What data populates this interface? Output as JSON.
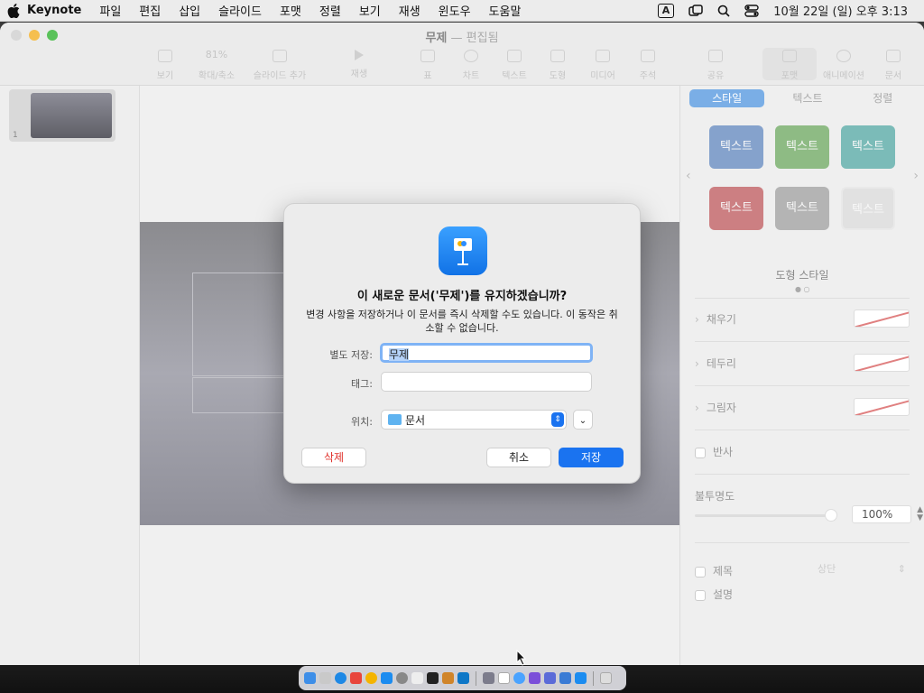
{
  "menubar": {
    "app_name": "Keynote",
    "items": [
      "파일",
      "편집",
      "삽입",
      "슬라이드",
      "포맷",
      "정렬",
      "보기",
      "재생",
      "윈도우",
      "도움말"
    ],
    "input_badge": "A",
    "clock": "10월 22일 (일) 오후 3:13"
  },
  "window": {
    "doc_name": "무제",
    "doc_status": "— 편집됨",
    "toolbar": {
      "view": "보기",
      "zoom_value": "81%",
      "zoom_label": "확대/축소",
      "add_slide": "슬라이드 추가",
      "play": "재생",
      "table": "표",
      "chart": "차트",
      "text": "텍스트",
      "shape": "도형",
      "media": "미디어",
      "comment": "주석",
      "share": "공유",
      "format": "포맷",
      "animate": "애니메이션",
      "document": "문서"
    }
  },
  "sidebar": {
    "slide_number": "1"
  },
  "inspector": {
    "tabs": [
      "스타일",
      "텍스트",
      "정렬"
    ],
    "style_buttons": [
      {
        "label": "텍스트",
        "color": "#3f6fb5"
      },
      {
        "label": "텍스트",
        "color": "#4e9a3e"
      },
      {
        "label": "텍스트",
        "color": "#2f9a95"
      },
      {
        "label": "텍스트",
        "color": "#b5353a"
      },
      {
        "label": "텍스트",
        "color": "#8e8e8e"
      },
      {
        "label": "텍스트",
        "color": "#d9d9d9"
      }
    ],
    "shape_style_label": "도형 스타일",
    "fill": "채우기",
    "border": "테두리",
    "shadow": "그림자",
    "reflection": "반사",
    "opacity_label": "불투명도",
    "opacity_value": "100%",
    "title_label": "제목",
    "title_position": "상단",
    "caption_label": "설명"
  },
  "dialog": {
    "title": "이 새로운 문서('무제')를 유지하겠습니까?",
    "message": "변경 사항을 저장하거나 이 문서를 즉시 삭제할 수도 있습니다. 이 동작은 취소할 수 없습니다.",
    "save_as_label": "별도 저장:",
    "save_as_value": "무제",
    "tags_label": "태그:",
    "tags_value": "",
    "location_label": "위치:",
    "location_value": "문서",
    "delete_label": "삭제",
    "cancel_label": "취소",
    "save_label": "저장"
  }
}
